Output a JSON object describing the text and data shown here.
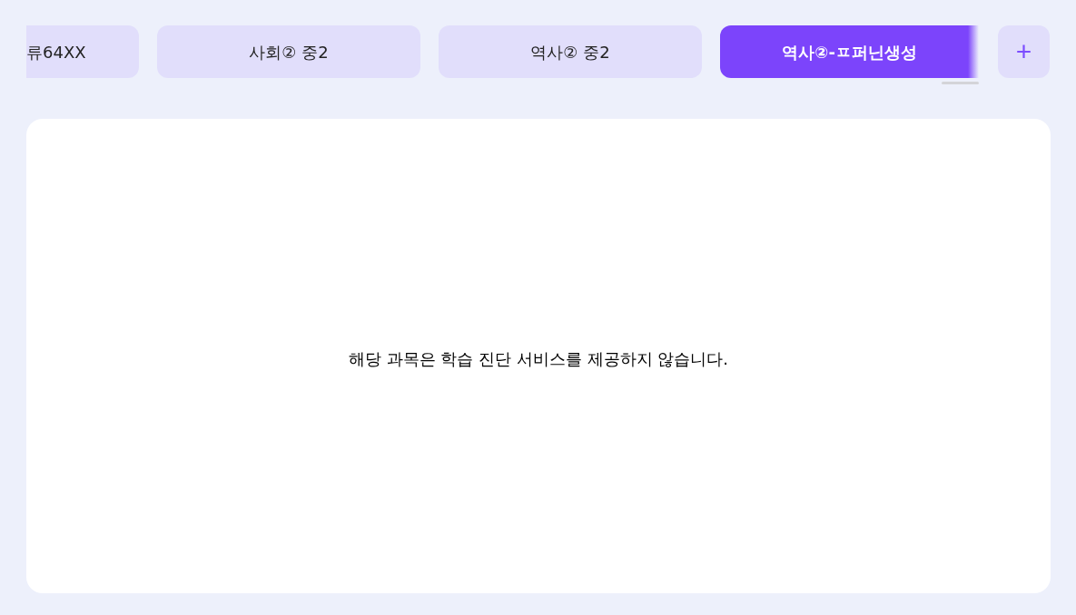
{
  "tabs": [
    {
      "label": "류64XX",
      "selected": false
    },
    {
      "label": "사회② 중2",
      "selected": false
    },
    {
      "label": "역사② 중2",
      "selected": false
    },
    {
      "label": "역사②-ㅍ퍼닌생성",
      "selected": true
    }
  ],
  "add_button": {
    "label": "+"
  },
  "content": {
    "message": "해당 과목은 학습 진단 서비스를 제공하지 않습니다."
  }
}
